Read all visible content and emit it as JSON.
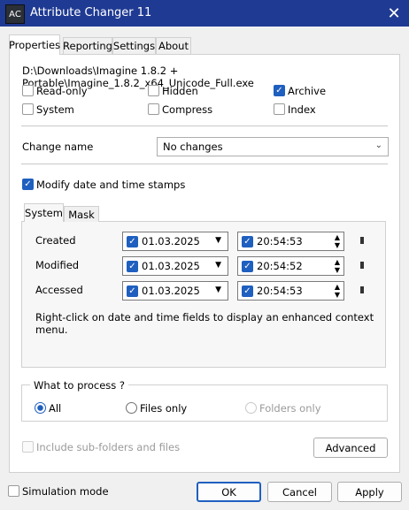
{
  "window": {
    "title": "Attribute Changer 11",
    "icon_text": "AC",
    "close_glyph": "✕"
  },
  "tabs": [
    "Properties",
    "Reporting",
    "Settings",
    "About"
  ],
  "file_path": "D:\\Downloads\\Imagine 1.8.2 + Portable\\Imagine_1.8.2_x64_Unicode_Full.exe",
  "attributes": [
    {
      "label": "Read-only",
      "checked": false
    },
    {
      "label": "Hidden",
      "checked": false
    },
    {
      "label": "Archive",
      "checked": true
    },
    {
      "label": "System",
      "checked": false
    },
    {
      "label": "Compress",
      "checked": false
    },
    {
      "label": "Index",
      "checked": false
    }
  ],
  "change_name": {
    "label": "Change name",
    "value": "No changes"
  },
  "modify_dates": {
    "label": "Modify date and time stamps",
    "checked": true
  },
  "subtabs": [
    "System",
    "Mask"
  ],
  "timestamps": [
    {
      "label": "Created",
      "date": "01.03.2025",
      "time": "20:54:53"
    },
    {
      "label": "Modified",
      "date": "01.03.2025",
      "time": "20:54:52"
    },
    {
      "label": "Accessed",
      "date": "01.03.2025",
      "time": "20:54:53"
    }
  ],
  "hint": "Right-click on date and time fields to display an enhanced context menu.",
  "process": {
    "title": "What to process ?",
    "options": [
      {
        "label": "All",
        "selected": true,
        "enabled": true
      },
      {
        "label": "Files only",
        "selected": false,
        "enabled": true
      },
      {
        "label": "Folders only",
        "selected": false,
        "enabled": false
      }
    ]
  },
  "include_subfolders": {
    "label": "Include sub-folders and files",
    "enabled": false
  },
  "advanced_label": "Advanced",
  "simulation": {
    "label": "Simulation mode",
    "checked": false
  },
  "buttons": {
    "ok": "OK",
    "cancel": "Cancel",
    "apply": "Apply"
  },
  "colors": {
    "titlebar": "#1f3a93",
    "accent": "#1f5fbf"
  }
}
